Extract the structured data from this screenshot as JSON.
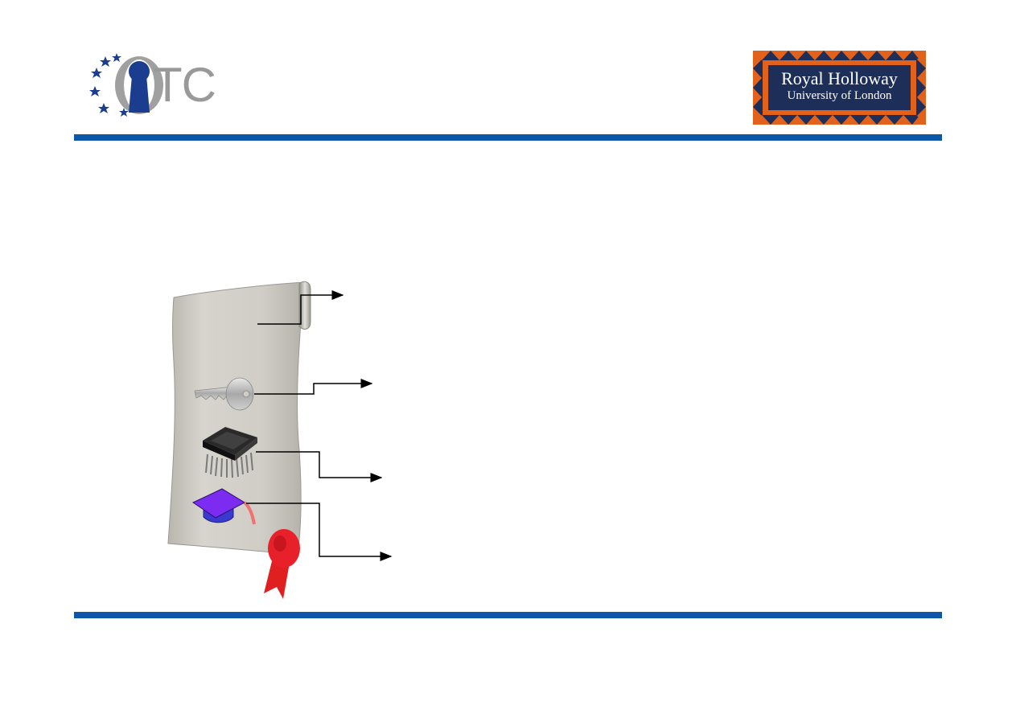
{
  "header": {
    "logo_left": {
      "text": "TC",
      "icon": "keyhole-stars-logo",
      "colors": {
        "stars": "#1a3d8f",
        "keyhole": "#1a3d8f",
        "ring": "#a0a0a0",
        "text": "#999999"
      }
    },
    "logo_right": {
      "title": "Royal Holloway",
      "subtitle": "University of London",
      "icon": "royal-holloway-crest-logo",
      "colors": {
        "border": "#1d2f58",
        "pattern": "#e2621b",
        "inner": "#1d2f58",
        "text": "#ffffff"
      }
    }
  },
  "theme": {
    "rule_color": "#0d57a8"
  },
  "diagram": {
    "items": [
      {
        "icon": "scroll-top-icon"
      },
      {
        "icon": "key-icon"
      },
      {
        "icon": "chip-icon"
      },
      {
        "icon": "graduation-cap-icon"
      },
      {
        "icon": "red-seal-ribbon-icon"
      }
    ]
  }
}
